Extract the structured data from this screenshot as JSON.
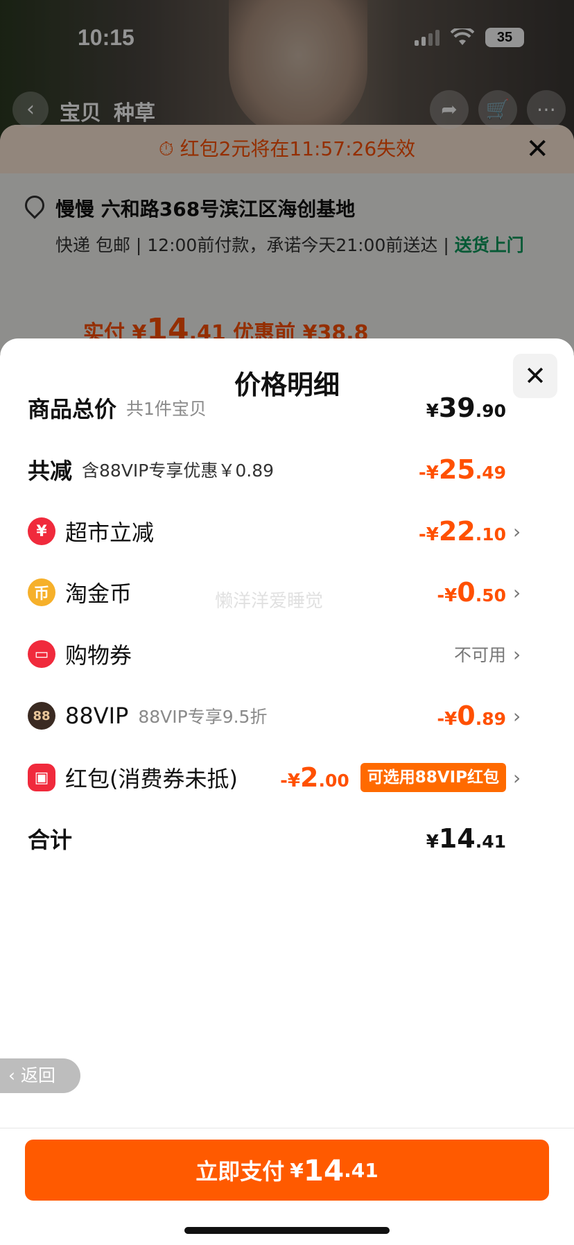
{
  "status_bar": {
    "time": "10:15",
    "battery": "35"
  },
  "top_nav": {
    "tab1": "宝贝",
    "tab2": "种草"
  },
  "order": {
    "countdown": "红包2元将在11:57:26失效",
    "address_name": "慢慢",
    "address": "六和路368号滨江区海创基地",
    "delivery": "快递 包邮",
    "promise": "12:00前付款，承诺今天21:00前送达",
    "door": "送货上门",
    "price_peek_label": "实付 ¥",
    "price_peek_int": "14",
    "price_peek_dec": ".41",
    "price_peek_before": "优惠前 ¥38.8"
  },
  "sheet": {
    "title": "价格明细",
    "watermark": "懒洋洋爱睡觉",
    "rows": {
      "total_goods": {
        "label": "商品总价",
        "sub": "共1件宝贝",
        "sym": "¥",
        "int": "39",
        "dec": ".90"
      },
      "reduction": {
        "label": "共减",
        "sub": "含88VIP专享优惠￥0.89",
        "sym": "-¥",
        "int": "25",
        "dec": ".49"
      },
      "supermarket": {
        "label": "超市立减",
        "icon_glyph": "¥",
        "sym": "-¥",
        "int": "22",
        "dec": ".10"
      },
      "coins": {
        "label": "淘金币",
        "icon_glyph": "币",
        "sym": "-¥",
        "int": "0",
        "dec": ".50"
      },
      "coupon": {
        "label": "购物券",
        "status": "不可用"
      },
      "vip": {
        "label": "88VIP",
        "icon_glyph": "88",
        "sub": "88VIP专享9.5折",
        "sym": "-¥",
        "int": "0",
        "dec": ".89"
      },
      "red_packet": {
        "label": "红包(消费券未抵)",
        "sym": "-¥",
        "int": "2",
        "dec": ".00",
        "tag": "可选用88VIP红包"
      },
      "sum": {
        "label": "合计",
        "sym": "¥",
        "int": "14",
        "dec": ".41"
      }
    },
    "back_label": "返回",
    "pay": {
      "label": "立即支付",
      "sym": "¥",
      "int": "14",
      "dec": ".41"
    }
  },
  "colors": {
    "accent": "#ff5000",
    "pay_button": "#ff5a00",
    "green": "#0a9a5c"
  }
}
